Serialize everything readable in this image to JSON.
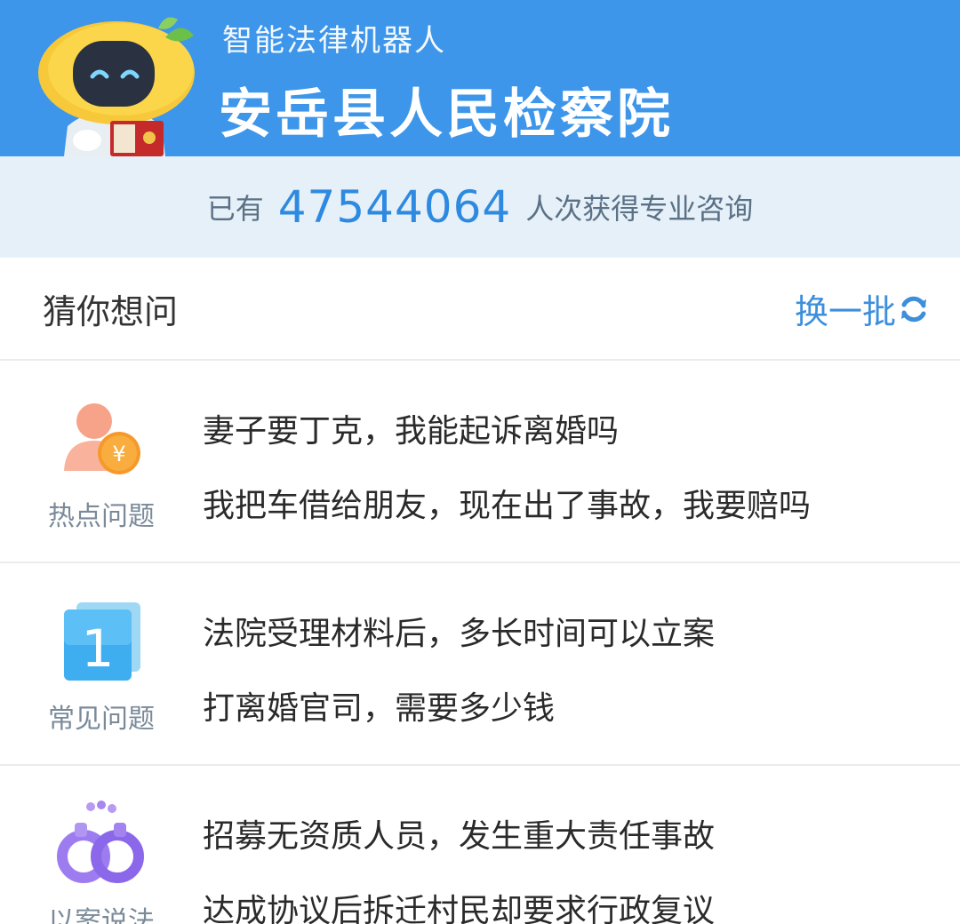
{
  "header": {
    "subtitle": "智能法律机器人",
    "title": "安岳县人民检察院"
  },
  "stats": {
    "prefix": "已有",
    "count": "47544064",
    "suffix": "人次获得专业咨询"
  },
  "guess": {
    "title": "猜你想问",
    "refresh_label": "换一批"
  },
  "sections": [
    {
      "category": "热点问题",
      "icon": "person-yen-icon",
      "questions": [
        "妻子要丁克，我能起诉离婚吗",
        "我把车借给朋友，现在出了事故，我要赔吗"
      ]
    },
    {
      "category": "常见问题",
      "icon": "number-one-card-icon",
      "questions": [
        "法院受理材料后，多长时间可以立案",
        "打离婚官司，需要多少钱"
      ]
    },
    {
      "category": "以案说法",
      "icon": "handcuffs-icon",
      "questions": [
        "招募无资质人员，发生重大责任事故",
        "达成协议后拆迁村民却要求行政复议"
      ]
    }
  ],
  "colors": {
    "header_bg": "#3d96ea",
    "stats_bg": "#e6f0f9",
    "accent": "#2e8ae0"
  }
}
